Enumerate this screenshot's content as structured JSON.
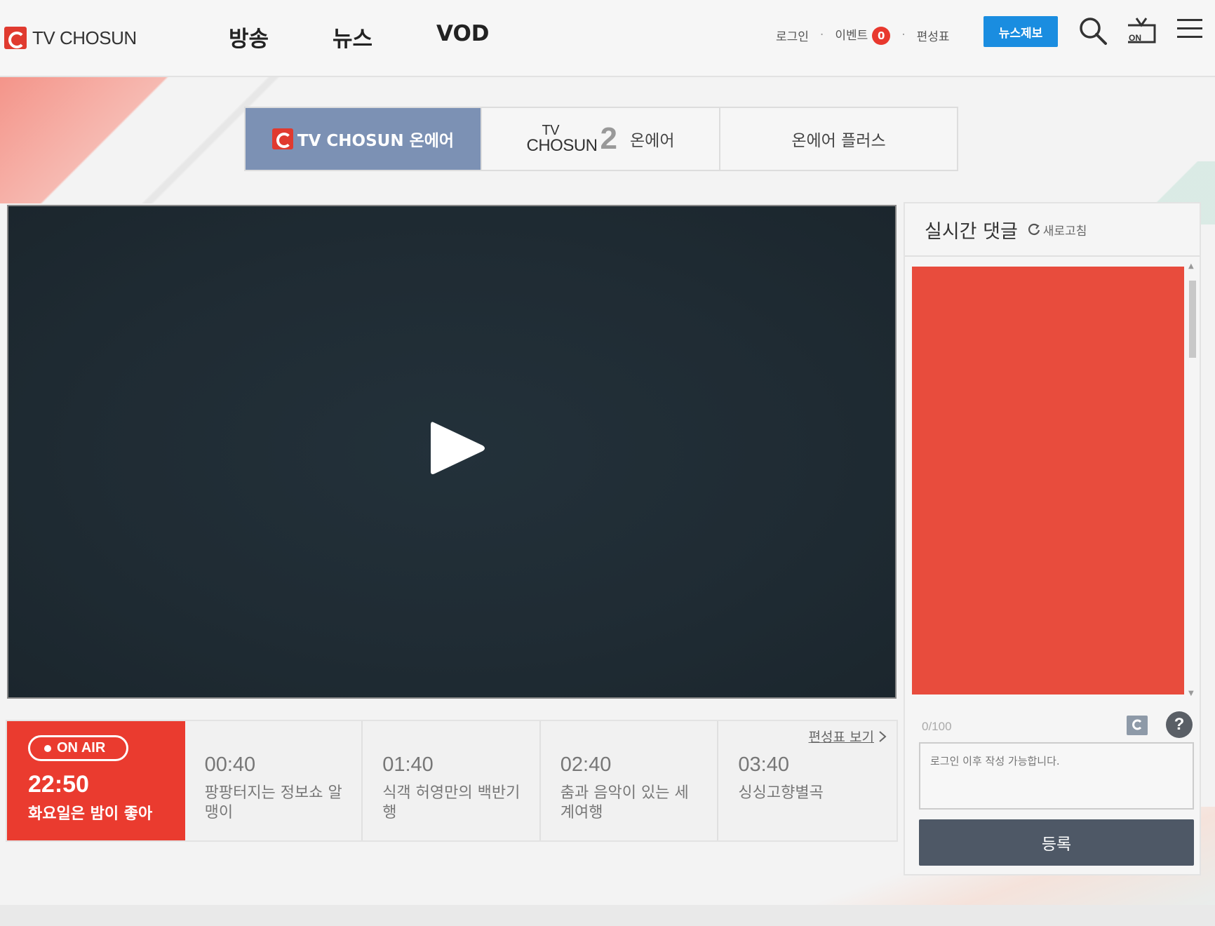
{
  "header": {
    "logo_text": "TV CHOSUN",
    "nav": [
      "방송",
      "뉴스",
      "VOD"
    ],
    "login": "로그인",
    "event": "이벤트",
    "event_count": "0",
    "schedule": "편성표",
    "news_tip": "뉴스제보"
  },
  "channel_tabs": {
    "tab1": "TV CHOSUN 온에어",
    "tab2_logo_top": "TV",
    "tab2_logo_bottom": "CHOSUN",
    "tab2_logo_num": "2",
    "tab2_label": "온에어",
    "tab3": "온에어 플러스"
  },
  "schedule": {
    "onair_label": "ON AIR",
    "current_time": "22:50",
    "current_title": "화요일은 밤이 좋아",
    "link": "편성표 보기",
    "items": [
      {
        "time": "00:40",
        "title": "팡팡터지는 정보쇼 알맹이"
      },
      {
        "time": "01:40",
        "title": "식객 허영만의 백반기행"
      },
      {
        "time": "02:40",
        "title": "춤과 음악이 있는 세계여행"
      },
      {
        "time": "03:40",
        "title": "싱싱고향별곡"
      }
    ]
  },
  "chat": {
    "title": "실시간 댓글",
    "refresh": "새로고침",
    "count": "0/100",
    "placeholder": "로그인 이후 작성 가능합니다.",
    "submit": "등록",
    "help": "?"
  },
  "colors": {
    "brand_red": "#ea3b2f",
    "active_tab": "#7c91b4",
    "news_tip_blue": "#1a8de0",
    "submit_gray": "#4e5866"
  }
}
